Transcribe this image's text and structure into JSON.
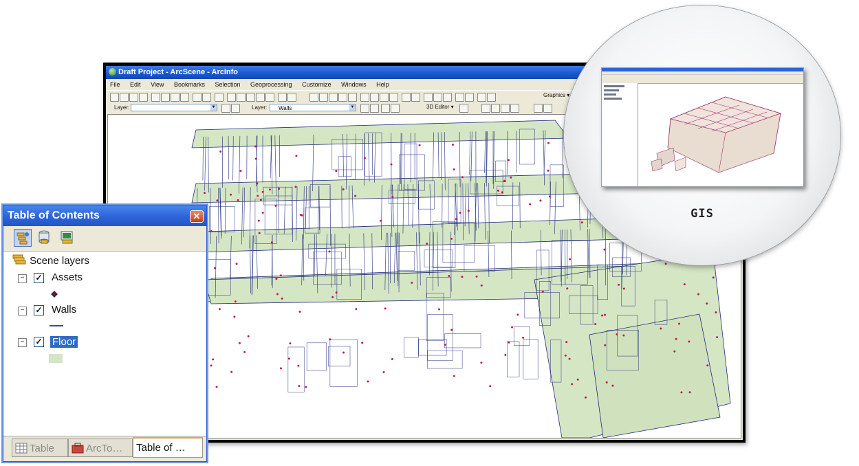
{
  "app": {
    "title": "Draft Project - ArcScene - ArcInfo",
    "menu": [
      "File",
      "Edit",
      "View",
      "Bookmarks",
      "Selection",
      "Geoprocessing",
      "Customize",
      "Windows",
      "Help"
    ],
    "graphics_label": "Graphics ▾",
    "layer_label_1": "Layer:",
    "layer_value_1": "",
    "layer_label_2": "Layer:",
    "layer_value_2": "Walls",
    "editor_label": "3D Editor ▾"
  },
  "magnifier": {
    "caption": "GIS"
  },
  "toc": {
    "title": "Table of Contents",
    "close_symbol": "✕",
    "group": "Scene layers",
    "layers": [
      {
        "name": "Assets",
        "checked": true,
        "symbol": "diamond",
        "symbol_color": "#5a1d3a"
      },
      {
        "name": "Walls",
        "checked": true,
        "symbol": "line",
        "symbol_color": "#3a4a9a"
      },
      {
        "name": "Floor",
        "checked": true,
        "symbol": "fill",
        "symbol_color": "#d3e5c3",
        "selected": true
      }
    ],
    "tabs": [
      "Table",
      "ArcTo…",
      "Table of …"
    ],
    "active_tab": 2
  },
  "colors": {
    "floor_fill": "#d5e6c4",
    "wall_stroke": "#1f2a7a",
    "asset_point": "#c2185b",
    "title_blue": "#2c63d8"
  }
}
